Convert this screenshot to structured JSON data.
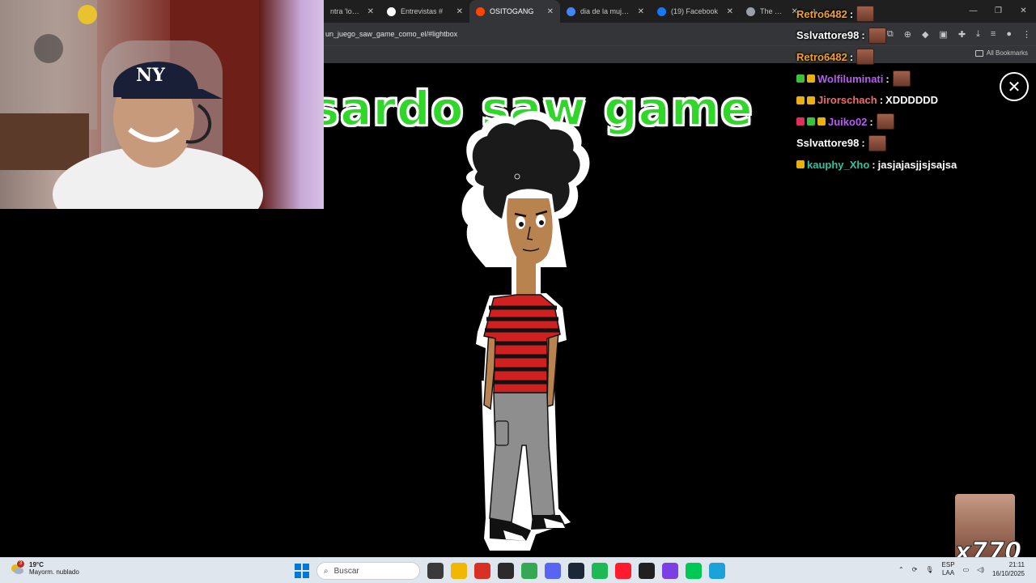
{
  "browser": {
    "tabs": [
      {
        "label": "ntra 'los ho",
        "icon": "globe-icon",
        "color": "#8ab4f8",
        "active": false
      },
      {
        "label": "Entrevistas #",
        "icon": "tiktok-icon",
        "color": "#ffffff",
        "active": false
      },
      {
        "label": "OSITOGANG",
        "icon": "reddit-icon",
        "color": "#ff4500",
        "active": true
      },
      {
        "label": "dia de la mujer p",
        "icon": "google-icon",
        "color": "#4285f4",
        "active": false
      },
      {
        "label": "(19) Facebook",
        "icon": "facebook-icon",
        "color": "#1877f2",
        "active": false
      },
      {
        "label": "The Project G",
        "icon": "globe-icon",
        "color": "#9aa0a6",
        "active": false
      }
    ],
    "url": "un_juego_saw_game_como_el/#lightbox",
    "all_bookmarks": "All Bookmarks"
  },
  "game": {
    "title": "isardo saw game"
  },
  "chat": [
    {
      "user": "Retro6482",
      "color": "#f0a030",
      "text": "",
      "emote": true,
      "badges": []
    },
    {
      "user": "Sslvattore98",
      "color": "#ffffff",
      "text": "",
      "emote": true,
      "badges": []
    },
    {
      "user": "Retro6482",
      "color": "#f0a030",
      "text": "",
      "emote": true,
      "badges": []
    },
    {
      "user": "Wolfiluminati",
      "color": "#b65cf2",
      "text": "",
      "emote": true,
      "badges": [
        "#3ac23a",
        "#e8b10e"
      ]
    },
    {
      "user": "Jirorschach",
      "color": "#f06a6a",
      "text": "XDDDDDD",
      "emote": false,
      "badges": [
        "#e8b10e",
        "#e8b10e"
      ]
    },
    {
      "user": "Juiko02",
      "color": "#b65cf2",
      "text": "",
      "emote": true,
      "badges": [
        "#e0305a",
        "#3ac23a",
        "#e8b10e"
      ]
    },
    {
      "user": "Sslvattore98",
      "color": "#ffffff",
      "text": "",
      "emote": true,
      "badges": []
    },
    {
      "user": "kauphy_Xho",
      "color": "#2ec4a0",
      "text": "jasjajasjjsjsajsa",
      "emote": false,
      "badges": [
        "#e8b10e"
      ]
    }
  ],
  "emote_combo": {
    "count": "x770"
  },
  "taskbar": {
    "notification_count": "3",
    "temperature": "19°C",
    "condition": "Mayorm. nublado",
    "search_placeholder": "Buscar",
    "lang_top": "ESP",
    "lang_bottom": "LAA",
    "time": "21:11",
    "date": "16/10/2025",
    "apps": [
      {
        "name": "task-view-icon",
        "color": "#3a3a3a"
      },
      {
        "name": "file-explorer-icon",
        "color": "#f2b705"
      },
      {
        "name": "app-red-icon",
        "color": "#d93025"
      },
      {
        "name": "obs-icon",
        "color": "#2b2b2b"
      },
      {
        "name": "chrome-icon",
        "color": "#34a853"
      },
      {
        "name": "discord-icon",
        "color": "#5865f2"
      },
      {
        "name": "steam-icon",
        "color": "#1b2838"
      },
      {
        "name": "spotify-icon",
        "color": "#1db954"
      },
      {
        "name": "opera-icon",
        "color": "#ff1b2d"
      },
      {
        "name": "app-dark-icon",
        "color": "#202020"
      },
      {
        "name": "app-purple-icon",
        "color": "#7b3fe4"
      },
      {
        "name": "app-green-icon",
        "color": "#00c853"
      },
      {
        "name": "notepad-icon",
        "color": "#1aa3d9"
      }
    ]
  }
}
